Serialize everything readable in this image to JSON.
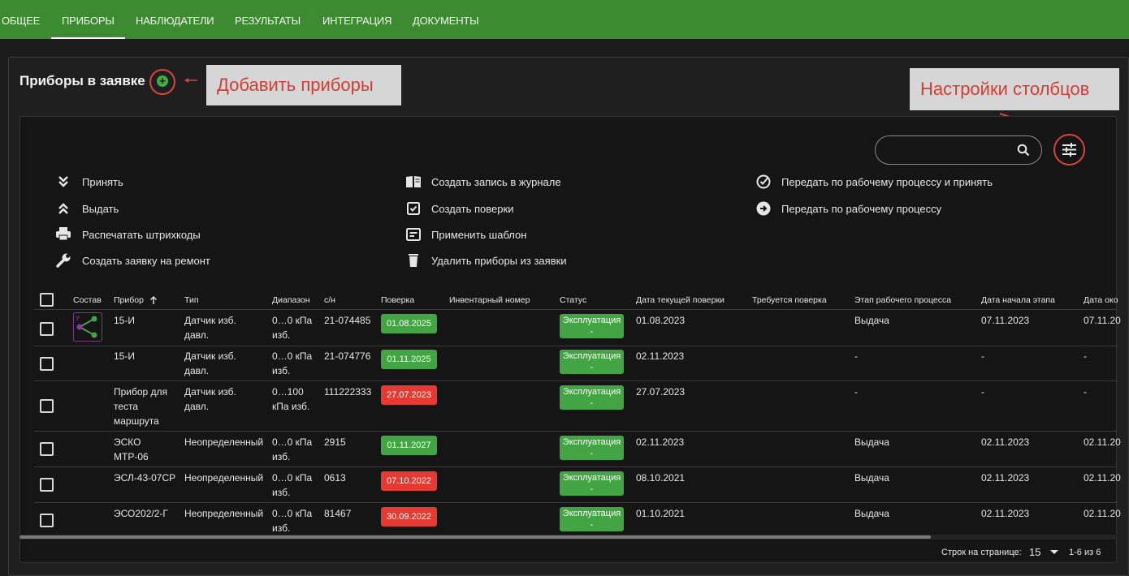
{
  "tabs": [
    {
      "label": "ОБЩЕЕ"
    },
    {
      "label": "ПРИБОРЫ"
    },
    {
      "label": "НАБЛЮДАТЕЛИ"
    },
    {
      "label": "РЕЗУЛЬТАТЫ"
    },
    {
      "label": "ИНТЕГРАЦИЯ"
    },
    {
      "label": "ДОКУМЕНТЫ"
    }
  ],
  "active_tab": "ПРИБОРЫ",
  "section_title": "Приборы в заявке",
  "callouts": {
    "add": "Добавить приборы",
    "columns": "Настройки столбцов"
  },
  "search": {
    "placeholder": "",
    "icon": "search-icon"
  },
  "actions": {
    "col1": [
      {
        "label": "Принять",
        "icon": "double-chevron-down-icon"
      },
      {
        "label": "Выдать",
        "icon": "double-chevron-up-icon"
      },
      {
        "label": "Распечатать штрихкоды",
        "icon": "printer-icon"
      },
      {
        "label": "Создать заявку на ремонт",
        "icon": "wrench-icon"
      }
    ],
    "col2": [
      {
        "label": "Создать запись в журнале",
        "icon": "book-icon"
      },
      {
        "label": "Создать поверки",
        "icon": "checkbox-icon"
      },
      {
        "label": "Применить шаблон",
        "icon": "template-icon"
      },
      {
        "label": "Удалить приборы из заявки",
        "icon": "trash-icon"
      }
    ],
    "col3": [
      {
        "label": "Передать по рабочему процессу и принять",
        "icon": "check-circle-icon"
      },
      {
        "label": "Передать по рабочему процессу",
        "icon": "arrow-circle-icon"
      }
    ]
  },
  "columns": [
    "Состав",
    "Прибор",
    "Тип",
    "Диапазон",
    "с/н",
    "Поверка",
    "Инвентарный номер",
    "Статус",
    "Дата текущей поверки",
    "Требуется поверка",
    "Этап рабочего процесса",
    "Дата начала этапа",
    "Дата око"
  ],
  "sorted_column_icon": "arrow-up-icon",
  "rows": [
    {
      "device": "15-И",
      "type": [
        "Датчик изб.",
        "давл."
      ],
      "range": [
        "0…0 кПа",
        "изб."
      ],
      "sn": "21-074485",
      "verification": "01.08.2025",
      "verification_state": "green",
      "status": [
        "Эксплуатация",
        "-"
      ],
      "current_verification": "01.08.2023",
      "stage": "Выдача",
      "stage_start": "07.11.2023",
      "stage_end": "07.11.20",
      "has_composition": true
    },
    {
      "device": "15-И",
      "type": [
        "Датчик изб.",
        "давл."
      ],
      "range": [
        "0…0 кПа",
        "изб."
      ],
      "sn": "21-074776",
      "verification": "01.11.2025",
      "verification_state": "green",
      "status": [
        "Эксплуатация",
        "-"
      ],
      "current_verification": "02.11.2023",
      "stage": "-",
      "stage_start": "-",
      "stage_end": "-",
      "has_composition": false
    },
    {
      "device": "Прибор для теста маршрута",
      "type": [
        "Датчик изб.",
        "давл."
      ],
      "range": [
        "0…100",
        "кПа изб."
      ],
      "sn": "111222333",
      "verification": "27.07.2023",
      "verification_state": "red",
      "status": [
        "Эксплуатация",
        "-"
      ],
      "current_verification": "27.07.2023",
      "stage": "-",
      "stage_start": "-",
      "stage_end": "-",
      "has_composition": false
    },
    {
      "device": "ЭСКО МТР-06",
      "type": [
        "Неопределенный"
      ],
      "range": [
        "0…0 кПа",
        "изб."
      ],
      "sn": "2915",
      "verification": "01.11.2027",
      "verification_state": "green",
      "status": [
        "Эксплуатация",
        "-"
      ],
      "current_verification": "02.11.2023",
      "stage": "Выдача",
      "stage_start": "02.11.2023",
      "stage_end": "02.11.20",
      "has_composition": false
    },
    {
      "device": "ЭСЛ-43-07СР",
      "type": [
        "Неопределенный"
      ],
      "range": [
        "0…0 кПа",
        "изб."
      ],
      "sn": "0613",
      "verification": "07.10.2022",
      "verification_state": "red",
      "status": [
        "Эксплуатация",
        "-"
      ],
      "current_verification": "08.10.2021",
      "stage": "Выдача",
      "stage_start": "02.11.2023",
      "stage_end": "02.11.20",
      "has_composition": false
    },
    {
      "device": "ЭСО202/2-Г",
      "type": [
        "Неопределенный"
      ],
      "range": [
        "0…0 кПа",
        "изб."
      ],
      "sn": "81467",
      "verification": "30.09.2022",
      "verification_state": "red",
      "status": [
        "Эксплуатация",
        "-"
      ],
      "current_verification": "01.10.2021",
      "stage": "Выдача",
      "stage_start": "02.11.2023",
      "stage_end": "02.11.20",
      "has_composition": false
    }
  ],
  "pagination": {
    "rows_label": "Строк на странице:",
    "rows_value": "15",
    "range": "1-6 из 6"
  },
  "colors": {
    "topbar": "#3d8b31",
    "accent_red": "#d9453a",
    "badge_green": "#43a443",
    "badge_red": "#e53a32"
  }
}
